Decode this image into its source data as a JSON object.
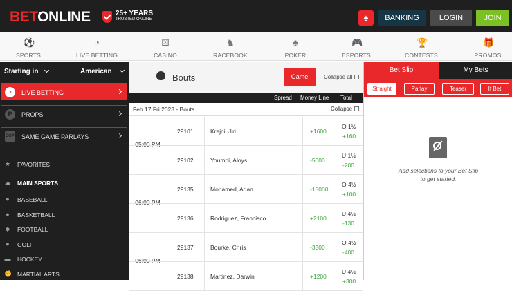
{
  "header": {
    "logo_bet": "BET",
    "logo_online": "ONLINE",
    "trust_line1": "25+ YEARS",
    "trust_line2": "TRUSTED ONLINE",
    "banking": "BANKING",
    "login": "LOGIN",
    "join": "JOIN",
    "spade_icon": "♠"
  },
  "nav": [
    {
      "label": "SPORTS",
      "icon": "⚽"
    },
    {
      "label": "LIVE BETTING",
      "icon": "◔"
    },
    {
      "label": "CASINO",
      "icon": "⚄"
    },
    {
      "label": "RACEBOOK",
      "icon": "♞"
    },
    {
      "label": "POKER",
      "icon": "♣"
    },
    {
      "label": "ESPORTS",
      "icon": "🎮"
    },
    {
      "label": "CONTESTS",
      "icon": "🏆"
    },
    {
      "label": "PROMOS",
      "icon": "🎁"
    }
  ],
  "sidebar": {
    "sort_label": "Starting in",
    "sort_value": "American",
    "boxes": [
      {
        "label": "LIVE BETTING",
        "icon": "◔"
      },
      {
        "label": "PROPS",
        "icon": "P"
      },
      {
        "label": "SAME GAME PARLAYS",
        "icon": "SGP"
      }
    ],
    "items": [
      {
        "label": "FAVORITES",
        "icon": "★"
      },
      {
        "label": "MAIN SPORTS",
        "icon": "☁"
      },
      {
        "label": "BASEBALL",
        "icon": "●"
      },
      {
        "label": "BASKETBALL",
        "icon": "●"
      },
      {
        "label": "FOOTBALL",
        "icon": "◆"
      },
      {
        "label": "GOLF",
        "icon": "●"
      },
      {
        "label": "HOCKEY",
        "icon": "▬"
      },
      {
        "label": "MARTIAL ARTS",
        "icon": "✊"
      }
    ]
  },
  "main": {
    "title": "Bouts",
    "game_button": "Game",
    "collapse_all": "Collapse all",
    "columns": {
      "spread": "Spread",
      "money_line": "Money Line",
      "total": "Total"
    },
    "date_label": "Feb 17 Fri 2023 - Bouts",
    "collapse": "Collapse",
    "times": [
      "05:00 PM",
      "06:00 PM",
      "06:00 PM"
    ],
    "rows": [
      {
        "rot": "29101",
        "name": "Krejci, Jiri",
        "ml": "+1600",
        "total_line": "O 1½",
        "total_price": "+160"
      },
      {
        "rot": "29102",
        "name": "Youmbi, Aloys",
        "ml": "-5000",
        "total_line": "U 1½",
        "total_price": "-200"
      },
      {
        "rot": "29135",
        "name": "Mohamed, Adan",
        "ml": "-15000",
        "total_line": "O 4½",
        "total_price": "+100"
      },
      {
        "rot": "29136",
        "name": "Rodriguez, Francisco",
        "ml": "+2100",
        "total_line": "U 4½",
        "total_price": "-130"
      },
      {
        "rot": "29137",
        "name": "Bourke, Chris",
        "ml": "-3300",
        "total_line": "O 4½",
        "total_price": "-400"
      },
      {
        "rot": "29138",
        "name": "Martinez, Darwin",
        "ml": "+1200",
        "total_line": "U 4½",
        "total_price": "+300"
      }
    ]
  },
  "betslip": {
    "tab_slip": "Bet Slip",
    "tab_mybets": "My Bets",
    "types": [
      "Straight",
      "Parlay",
      "Teaser",
      "If Bet"
    ],
    "empty_line1": "Add selections to your Bet Slip",
    "empty_line2": "to get started."
  },
  "colors": {
    "brand_red": "#e8282b",
    "join_green": "#7cc123",
    "banking_navy": "#163646",
    "odds_green": "#3aa53a"
  }
}
